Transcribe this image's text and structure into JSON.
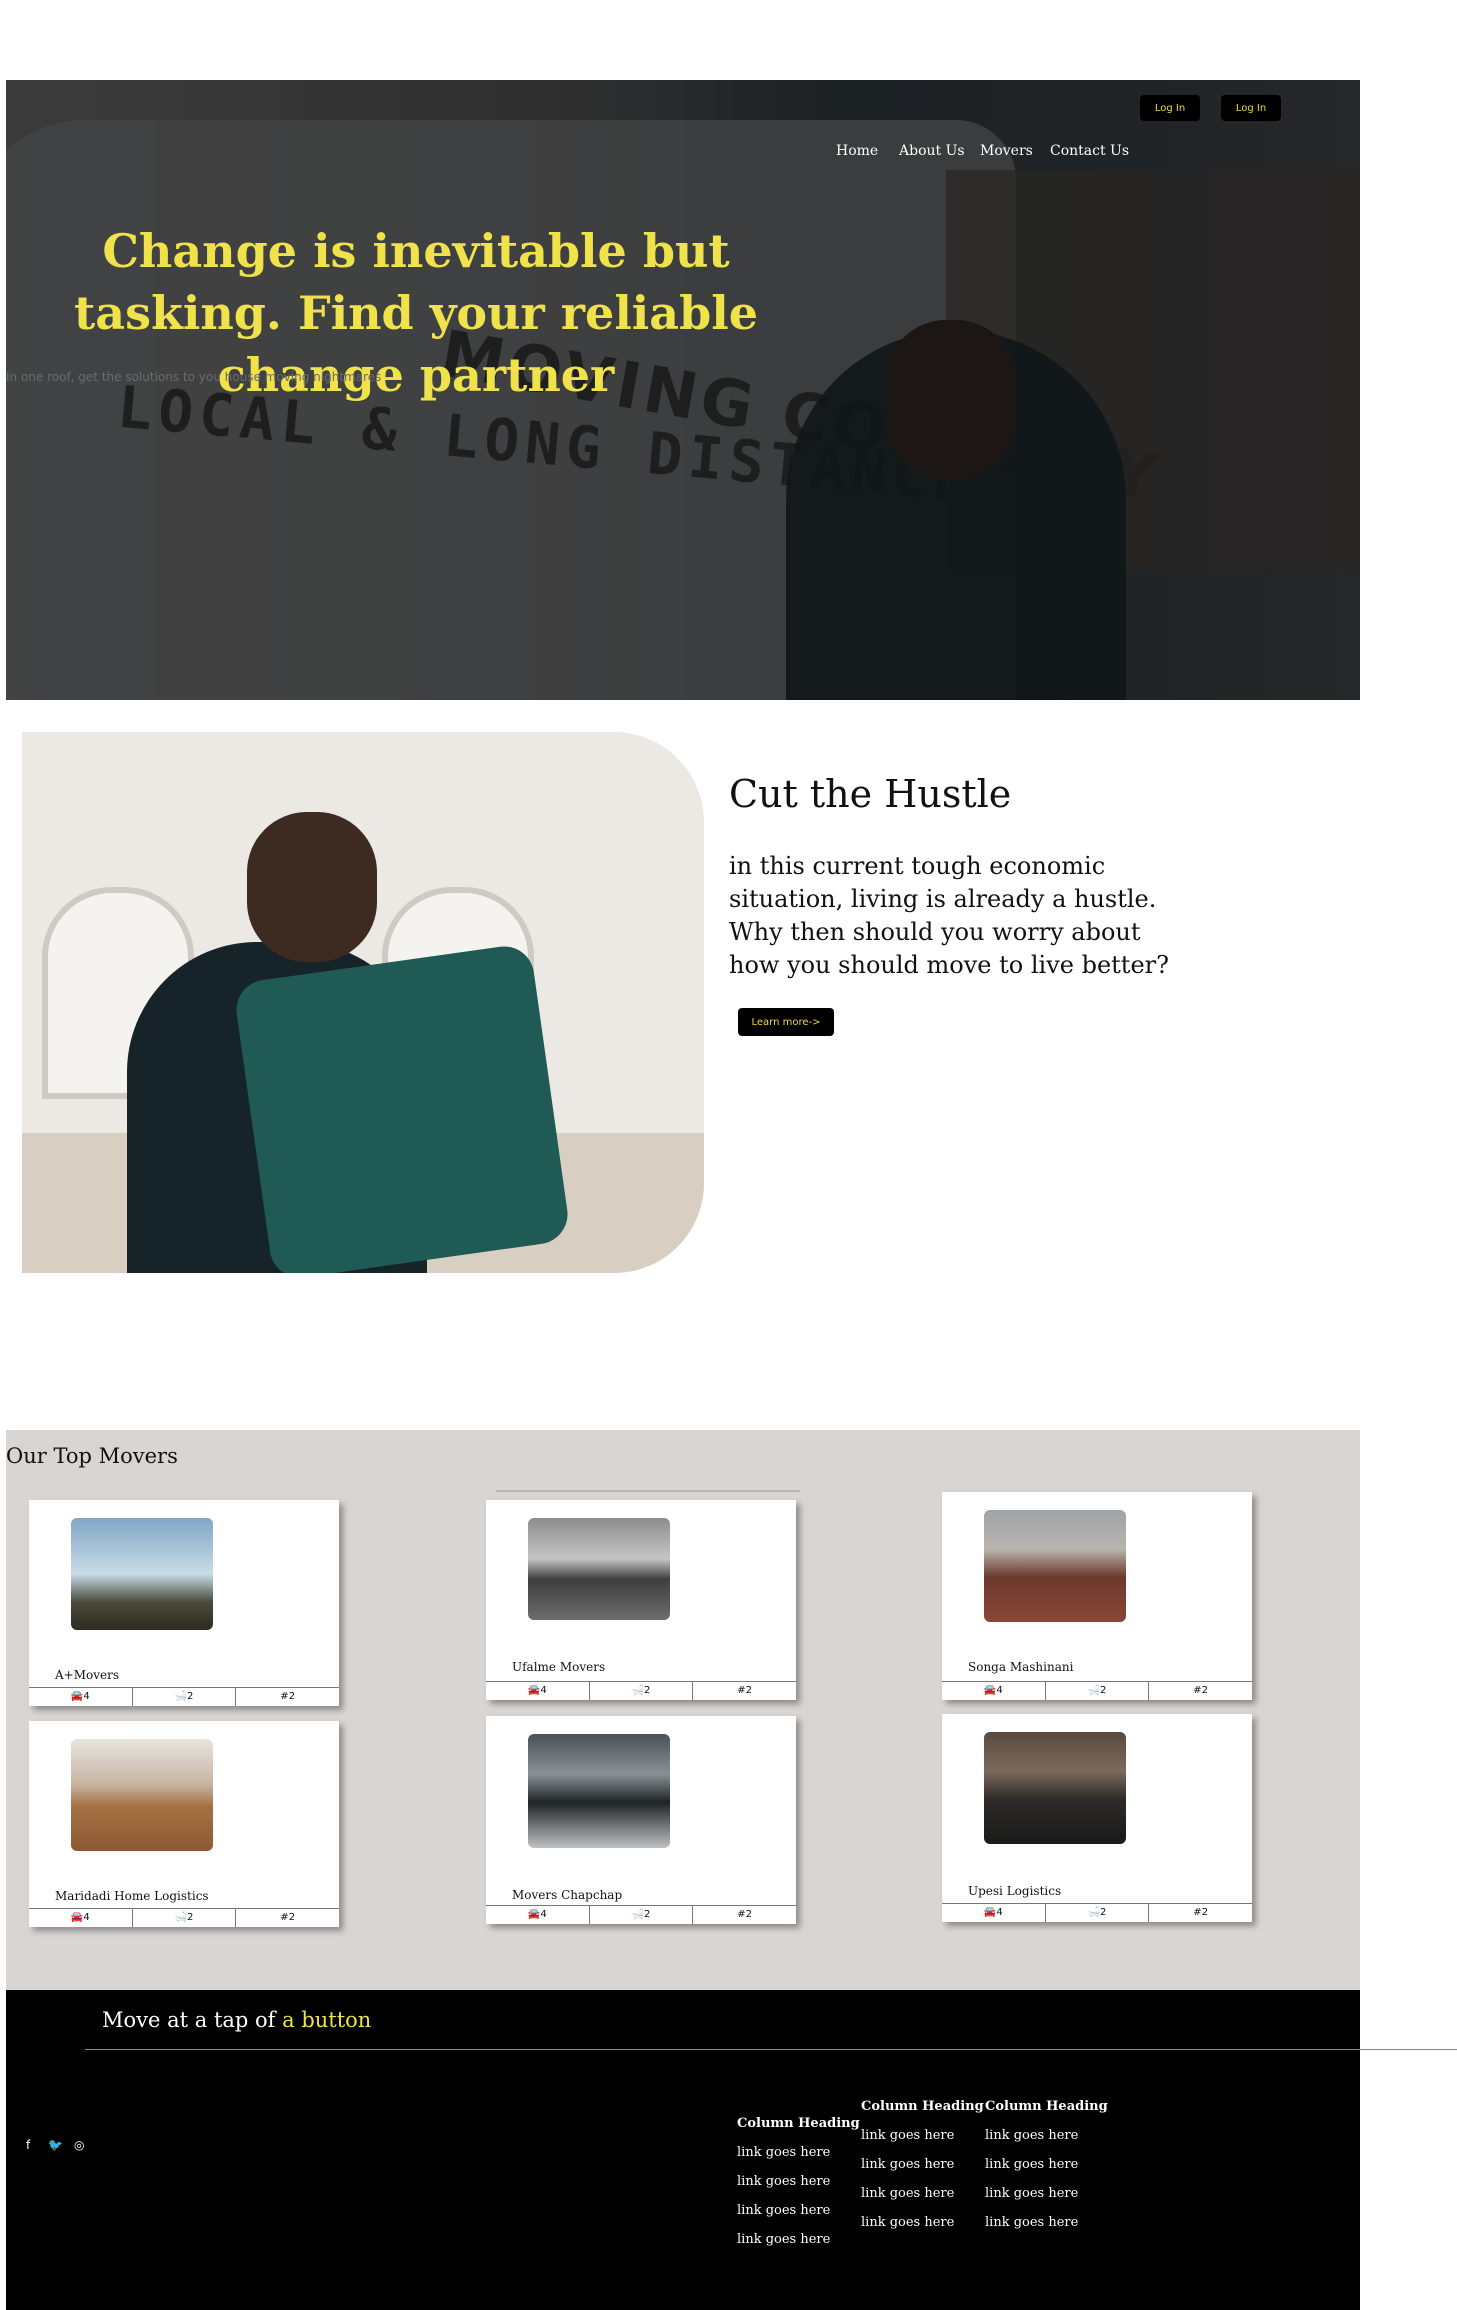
{
  "nav": {
    "links": [
      "Home",
      "About Us",
      "Movers",
      "Contact Us"
    ],
    "login_1": "Log In",
    "login_2": "Log In"
  },
  "hero": {
    "title": "Change is inevitable but tasking. Find your reliable change partner",
    "subtitle": "In one roof, get the solutions to you house moving nightmares",
    "image_text_1": "MOVING COMPANY",
    "image_text_2": "LOCAL & LONG DISTANCE"
  },
  "hustle": {
    "title": "Cut the Hustle",
    "text": "in this current tough economic situation, living is already a hustle. Why then should you worry about how you should move to live better?",
    "button": "Learn more->"
  },
  "movers": {
    "title": "Our Top Movers",
    "cards": [
      {
        "name": "A+Movers",
        "trucks": "4",
        "seats": "2",
        "rank": "2"
      },
      {
        "name": "Ufalme Movers",
        "trucks": "4",
        "seats": "2",
        "rank": "2"
      },
      {
        "name": "Songa Mashinani",
        "trucks": "4",
        "seats": "2",
        "rank": "2"
      },
      {
        "name": "Maridadi Home Logistics",
        "trucks": "4",
        "seats": "2",
        "rank": "2"
      },
      {
        "name": "Movers Chapchap",
        "trucks": "4",
        "seats": "2",
        "rank": "2"
      },
      {
        "name": "Upesi Logistics",
        "trucks": "4",
        "seats": "2",
        "rank": "2"
      }
    ],
    "icons": {
      "truck": "car-icon",
      "seat": "bath-icon",
      "rank": "hash-icon"
    }
  },
  "footer": {
    "tag_plain": "Move at a tap of ",
    "tag_highlight": "a button",
    "social": [
      "facebook-icon",
      "twitter-icon",
      "instagram-icon"
    ],
    "columns": [
      {
        "heading": "Column Heading",
        "links": [
          "link goes here",
          "link goes here",
          "link goes here",
          "link goes here"
        ]
      },
      {
        "heading": "Column Heading",
        "links": [
          "link goes here",
          "link goes here",
          "link goes here",
          "link goes here"
        ]
      },
      {
        "heading": "Column Heading",
        "links": [
          "link goes here",
          "link goes here",
          "link goes here",
          "link goes here"
        ]
      }
    ]
  },
  "colors": {
    "accent": "#f0e24b",
    "dark": "#000000",
    "section_bg": "#d9d5d3"
  }
}
